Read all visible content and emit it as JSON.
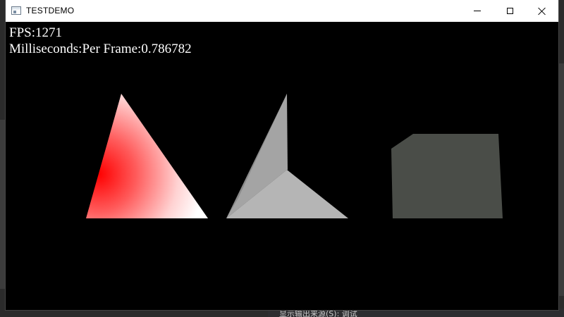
{
  "window": {
    "title": "TESTDEMO"
  },
  "hud": {
    "fps": "FPS:1271",
    "ms_per_frame": "Milliseconds:Per Frame:0.786782"
  },
  "background": {
    "status_text": "显示输出来源(S): 调试"
  },
  "scene": {
    "objects": [
      "gradient-triangle",
      "gray-pyramid",
      "dark-gray-cube"
    ],
    "colors": {
      "red": "#ff0000",
      "white": "#ffffff",
      "pyramid_light": "#b5b5b5",
      "pyramid_mid": "#a0a0a0",
      "pyramid_dark": "#8a8a8a",
      "cube": "#4a4d48"
    }
  }
}
